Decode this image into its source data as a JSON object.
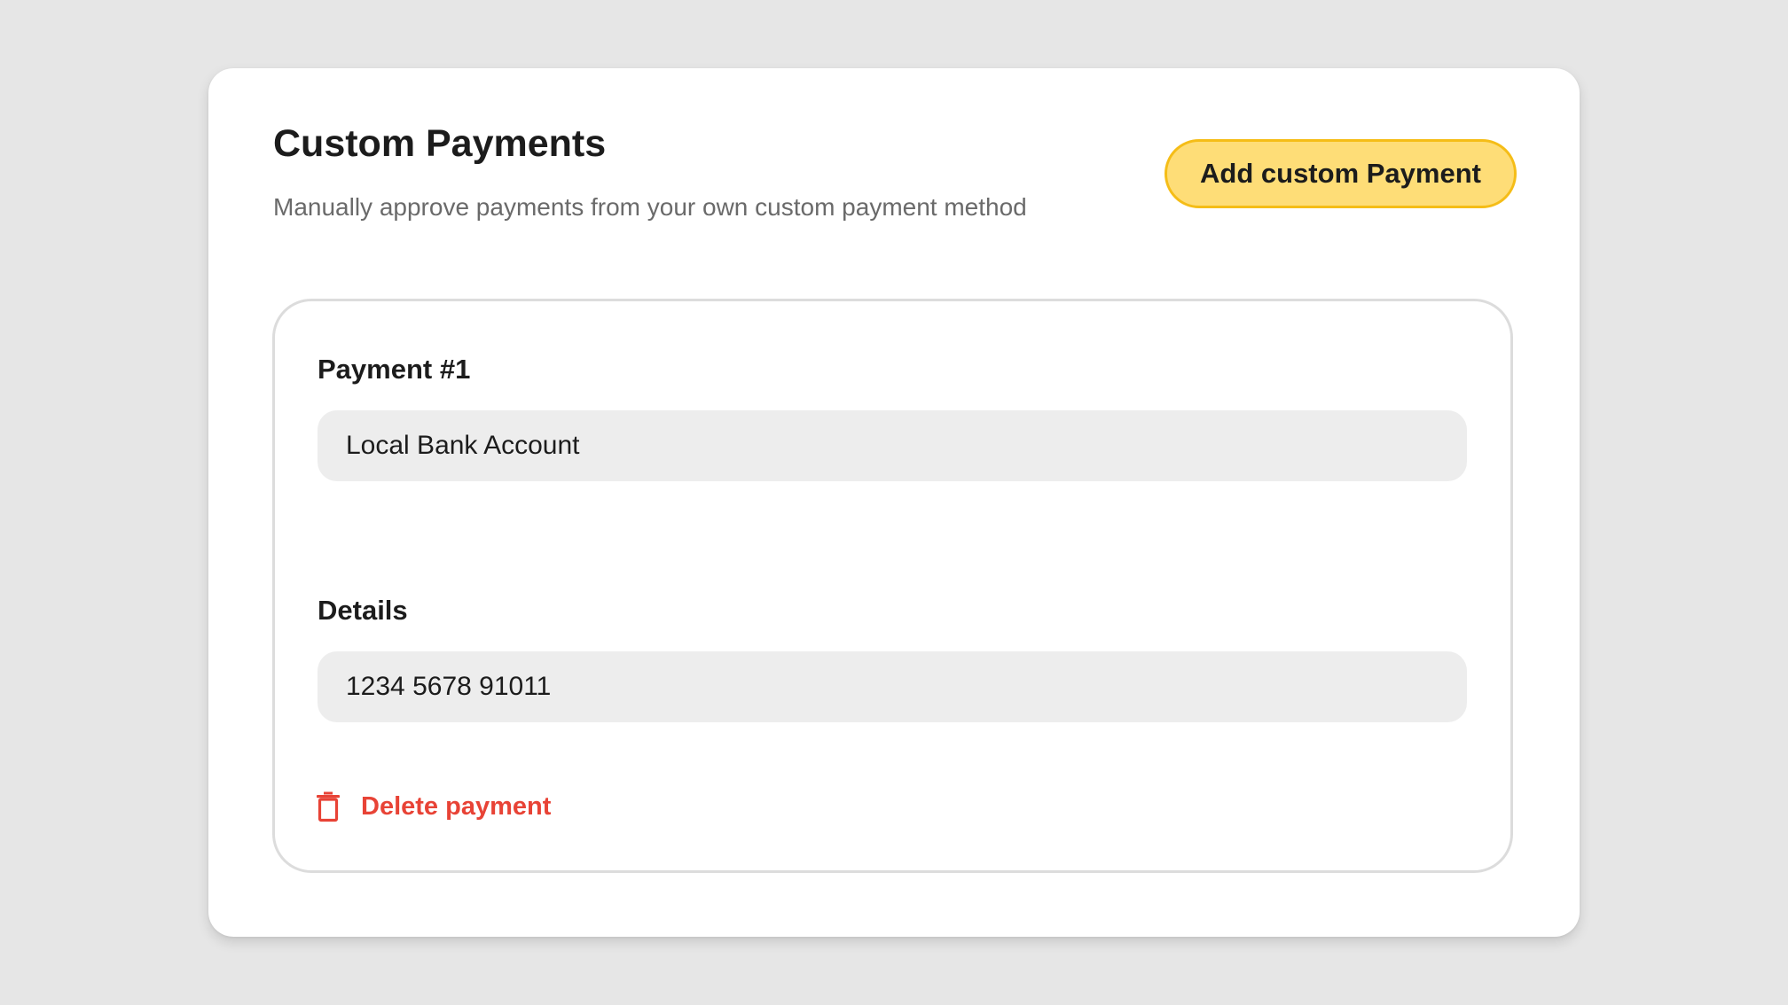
{
  "header": {
    "title": "Custom Payments",
    "subtitle": "Manually approve payments from your own custom payment method",
    "add_button_label": "Add custom Payment"
  },
  "payment": {
    "heading": "Payment #1",
    "name_value": "Local Bank Account",
    "details_label": "Details",
    "details_value": "1234 5678 91011",
    "delete_label": "Delete payment",
    "delete_icon": "trash-icon"
  },
  "colors": {
    "accent": "#fedd77",
    "accent_border": "#f5bd17",
    "danger": "#e84336",
    "input_bg": "#ededed",
    "page_bg": "#e6e6e6"
  }
}
